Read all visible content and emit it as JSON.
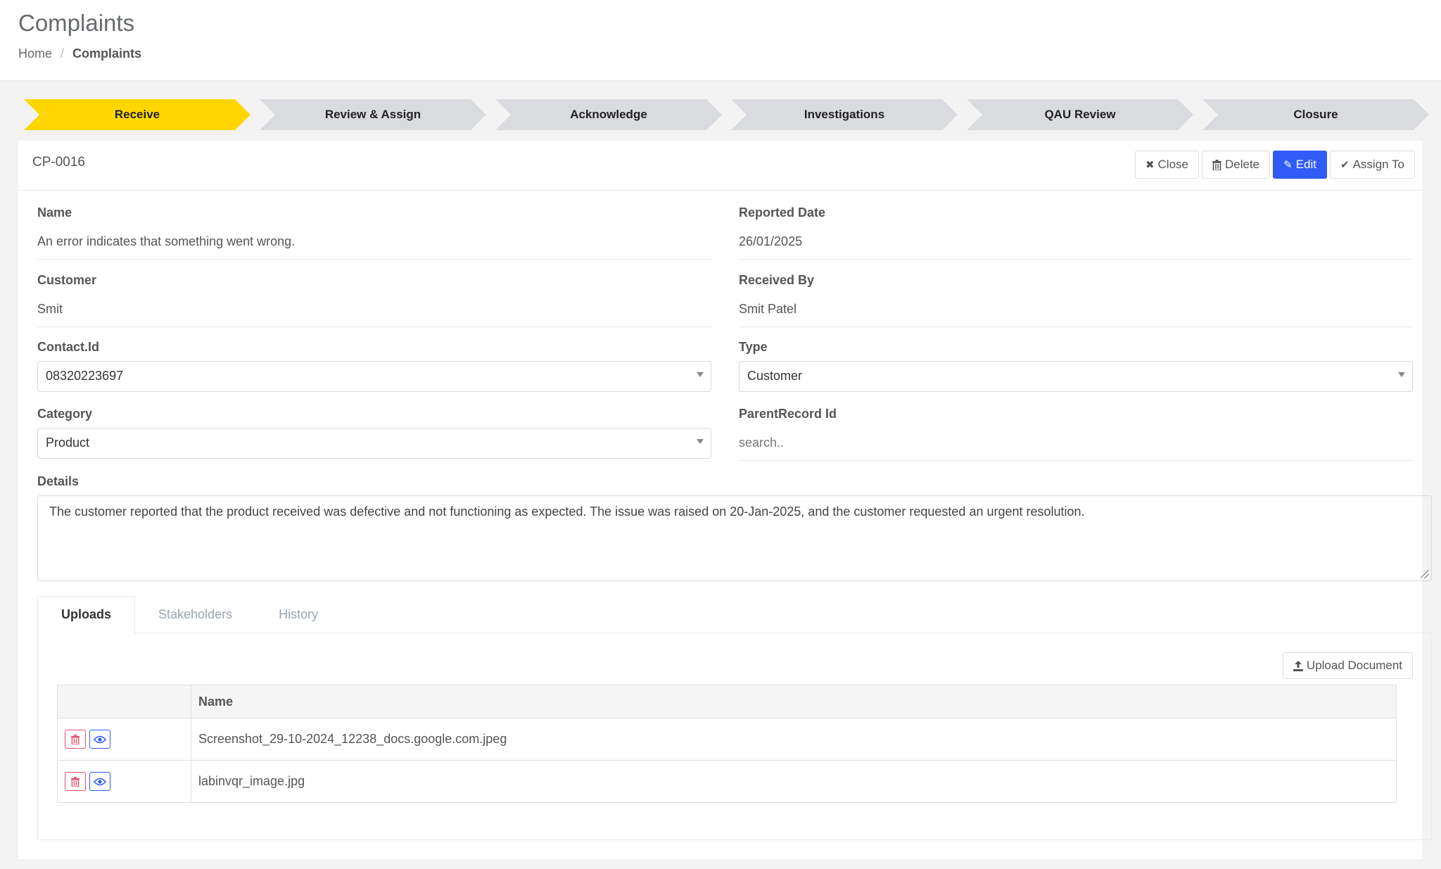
{
  "header": {
    "title": "Complaints",
    "breadcrumb": {
      "home": "Home",
      "separator": "/",
      "current": "Complaints"
    }
  },
  "workflow": {
    "steps": [
      "Receive",
      "Review & Assign",
      "Acknowledge",
      "Investigations",
      "QAU Review",
      "Closure"
    ],
    "active_step": "Receive",
    "active_color": "#ffd600"
  },
  "record": {
    "id": "CP-0016",
    "actions": {
      "close": "Close",
      "delete": "Delete",
      "edit": "Edit",
      "assign": "Assign To"
    },
    "fields": {
      "name_label": "Name",
      "name_value": "An error indicates that something went wrong.",
      "reported_date_label": "Reported Date",
      "reported_date_value": "26/01/2025",
      "customer_label": "Customer",
      "customer_value": "Smit",
      "received_by_label": "Received By",
      "received_by_value": "Smit Patel",
      "contact_label": "Contact.Id",
      "contact_value": "08320223697",
      "type_label": "Type",
      "type_value": "Customer",
      "category_label": "Category",
      "category_value": "Product",
      "parent_label": "ParentRecord Id",
      "parent_placeholder": "search..",
      "details_label": "Details",
      "details_value": "The customer reported that the product received was defective and not functioning as expected. The issue was raised on 20-Jan-2025, and the customer requested an urgent resolution."
    }
  },
  "tabs": {
    "items": [
      "Uploads",
      "Stakeholders",
      "History"
    ],
    "active": "Uploads"
  },
  "uploads": {
    "upload_button": "Upload Document",
    "column_name": "Name",
    "files": [
      "Screenshot_29-10-2024_12238_docs.google.com.jpeg",
      "labinvqr_image.jpg"
    ]
  },
  "colors": {
    "primary": "#2f5cf7",
    "danger": "#e84f6b",
    "step_active": "#ffd600",
    "step_inactive": "#dadbdf"
  }
}
